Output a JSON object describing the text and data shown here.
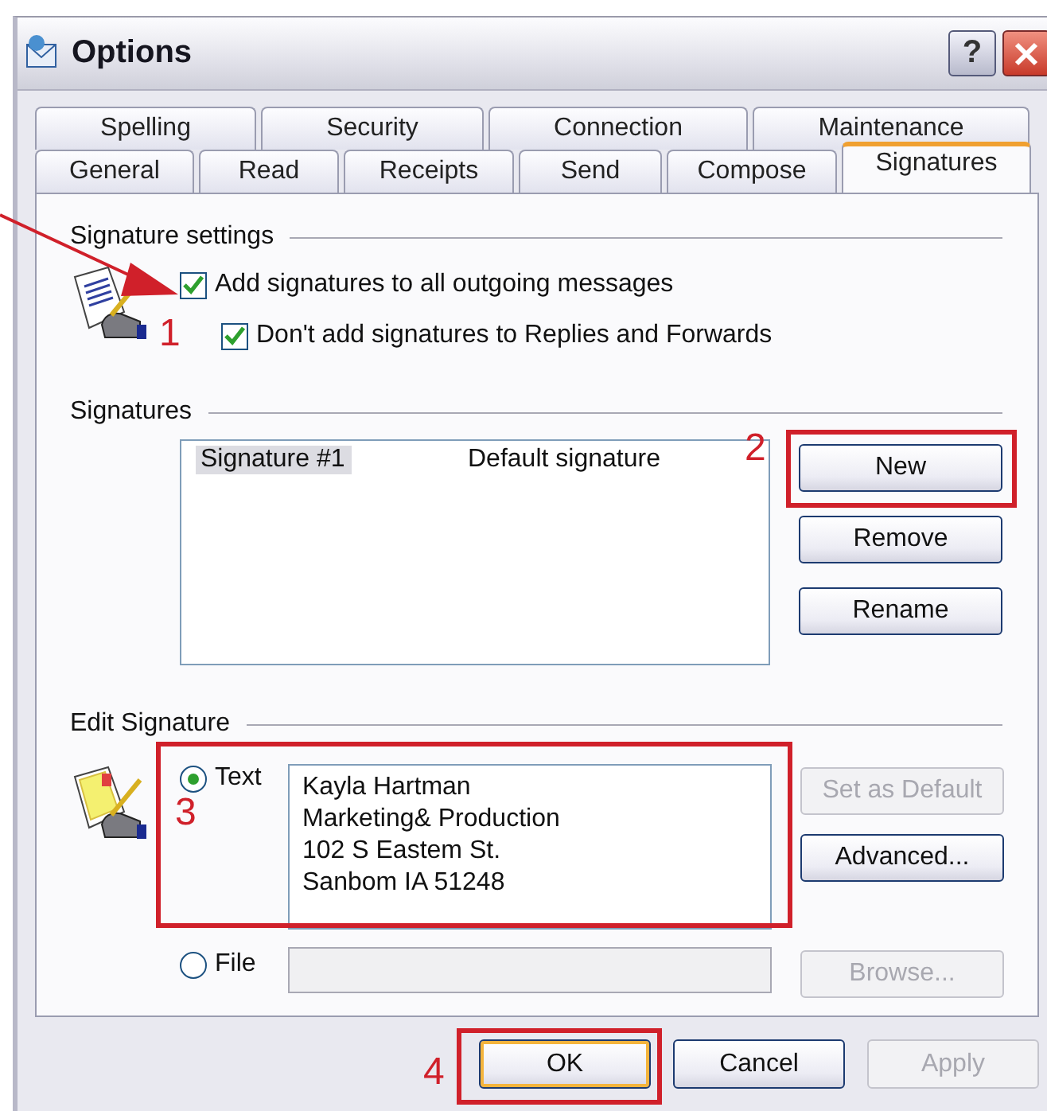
{
  "window": {
    "title": "Options",
    "help": "?"
  },
  "tab_rows": [
    {
      "tabs": [
        {
          "label": "Spelling",
          "selected": false
        },
        {
          "label": "Security",
          "selected": false
        },
        {
          "label": "Connection",
          "selected": false
        },
        {
          "label": "Maintenance",
          "selected": false
        }
      ]
    },
    {
      "tabs": [
        {
          "label": "General",
          "selected": false
        },
        {
          "label": "Read",
          "selected": false
        },
        {
          "label": "Receipts",
          "selected": false
        },
        {
          "label": "Send",
          "selected": false
        },
        {
          "label": "Compose",
          "selected": false
        },
        {
          "label": "Signatures",
          "selected": true
        }
      ]
    }
  ],
  "signature_settings": {
    "title": "Signature settings",
    "options": [
      {
        "label": "Add signatures to all outgoing messages",
        "checked": true
      },
      {
        "label": "Don't add signatures to Replies and Forwards",
        "checked": true
      }
    ]
  },
  "signatures": {
    "title": "Signatures",
    "list": [
      {
        "name": "Signature #1",
        "note": "Default signature",
        "selected": true
      }
    ],
    "buttons": [
      {
        "label": "New",
        "disabled": false
      },
      {
        "label": "Remove",
        "disabled": false
      },
      {
        "label": "Rename",
        "disabled": false
      }
    ]
  },
  "edit_signature": {
    "title": "Edit Signature",
    "sources": [
      {
        "label": "Text",
        "selected": true
      },
      {
        "label": "File",
        "selected": false
      }
    ],
    "text": "Kayla Hartman\nMarketing& Production\n102 S Eastem St.\nSanbom IA 51248",
    "buttons": [
      {
        "label": "Set as Default",
        "disabled": true
      },
      {
        "label": "Advanced...",
        "disabled": false
      },
      {
        "label": "Browse...",
        "disabled": true
      }
    ]
  },
  "dialog_buttons": [
    {
      "label": "OK",
      "disabled": false,
      "default": true
    },
    {
      "label": "Cancel",
      "disabled": false,
      "default": false
    },
    {
      "label": "Apply",
      "disabled": true,
      "default": false
    }
  ],
  "annotations": [
    {
      "label": "1",
      "kind": "arrow"
    },
    {
      "label": "2",
      "kind": "box"
    },
    {
      "label": "3",
      "kind": "box"
    },
    {
      "label": "4",
      "kind": "box"
    }
  ]
}
